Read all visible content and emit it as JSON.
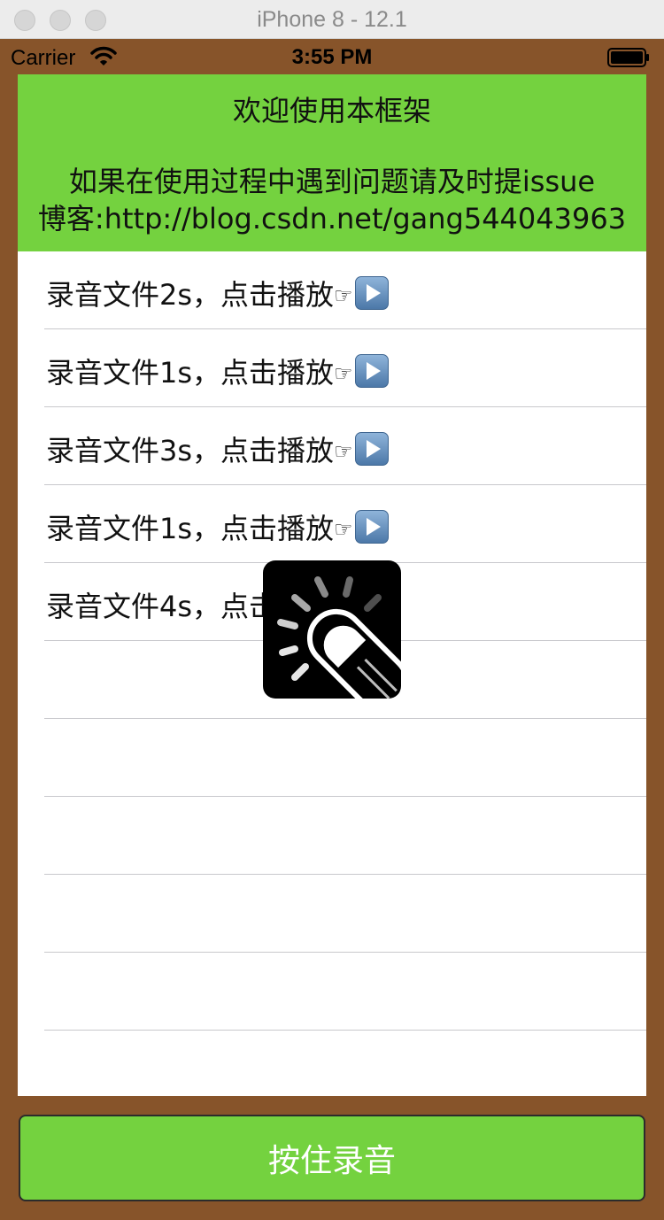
{
  "window": {
    "title": "iPhone 8 - 12.1"
  },
  "statusbar": {
    "carrier": "Carrier",
    "time": "3:55 PM"
  },
  "header": {
    "line1": "欢迎使用本框架",
    "line2": "如果在使用过程中遇到问题请及时提issue",
    "line3": "博客:http://blog.csdn.net/gang544043963"
  },
  "recordings": [
    {
      "label": "录音文件2s，点击播放"
    },
    {
      "label": "录音文件1s，点击播放"
    },
    {
      "label": "录音文件3s，点击播放"
    },
    {
      "label": "录音文件1s，点击播放"
    },
    {
      "label": "录音文件4s，点击播放"
    }
  ],
  "empty_rows": 6,
  "icons": {
    "pointer": "hand-pointing-right-icon",
    "play": "play-button-icon",
    "overlay": "touch-finger-icon"
  },
  "record_button": {
    "label": "按住录音"
  },
  "colors": {
    "frame": "#87542a",
    "accent_green": "#74d23f"
  }
}
